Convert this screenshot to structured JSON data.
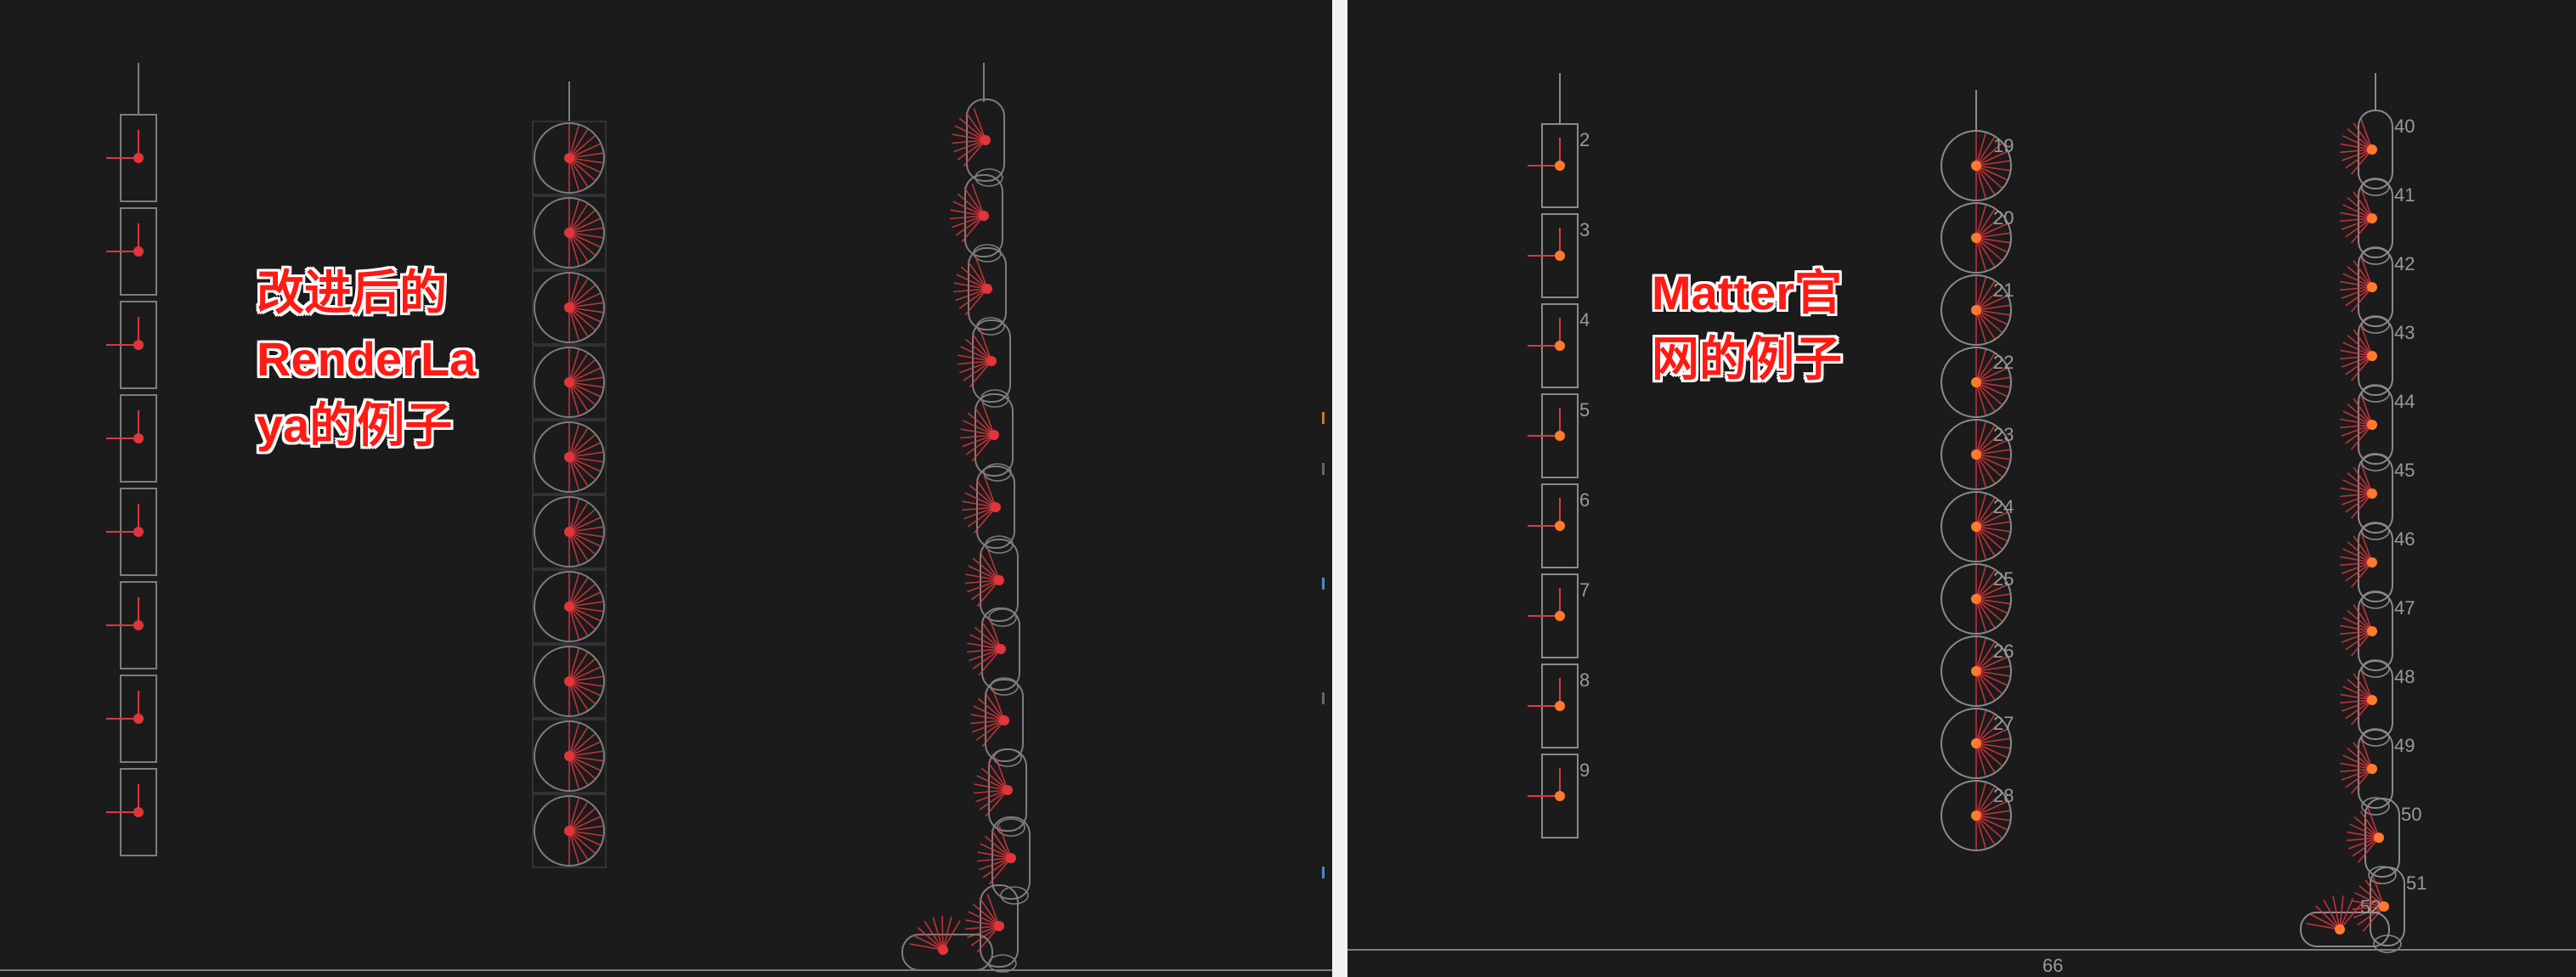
{
  "left_panel": {
    "caption": "改进后的\nRenderLa\nya的例子",
    "colors": {
      "outline": "#7d7d7d",
      "ray": "#e0363b",
      "center": "#e0363b"
    },
    "columns": [
      "rectangles",
      "circles",
      "capsule-chain"
    ]
  },
  "right_panel": {
    "caption": "Matter官\n网的例子",
    "colors": {
      "outline": "#8a8a8a",
      "ray": "#e0363b",
      "center": "#ff7a2e",
      "label": "#9a9a9a"
    },
    "rect_labels": [
      "2",
      "3",
      "4",
      "5",
      "6",
      "7",
      "8",
      "9"
    ],
    "circle_labels": [
      "19",
      "20",
      "21",
      "22",
      "23",
      "24",
      "25",
      "26",
      "27",
      "28"
    ],
    "chain_labels": [
      "40",
      "41",
      "42",
      "43",
      "44",
      "45",
      "46",
      "47",
      "48",
      "49",
      "50",
      "51",
      "52"
    ],
    "ground_label": "66"
  }
}
